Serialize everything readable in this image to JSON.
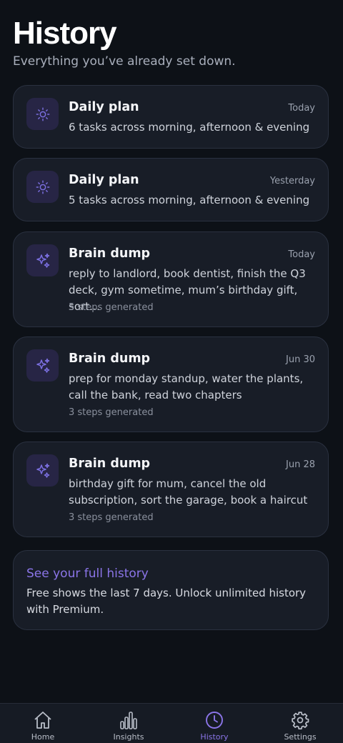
{
  "header": {
    "title": "History",
    "subtitle": "Everything you’ve already set down."
  },
  "entries": [
    {
      "title": "Daily plan",
      "date": "Today",
      "description": "6 tasks across morning, afternoon & evening",
      "icon": "sun-icon"
    },
    {
      "title": "Daily plan",
      "date": "Yesterday",
      "description": "5 tasks across morning, afternoon & evening",
      "icon": "sun-icon"
    },
    {
      "title": "Brain dump",
      "date": "Today",
      "description": "reply to landlord, book dentist, finish the Q3 deck, gym sometime, mum’s birthday gift, sort…",
      "meta": "5 steps generated",
      "icon": "sparkles-icon"
    },
    {
      "title": "Brain dump",
      "date": "Jun 30",
      "description": "prep for monday standup, water the plants, call the bank, read two chapters",
      "meta": "3 steps generated",
      "icon": "sparkles-icon"
    },
    {
      "title": "Brain dump",
      "date": "Jun 28",
      "description": "birthday gift for mum, cancel the old subscription, sort the garage, book a haircut",
      "meta": "3 steps generated",
      "icon": "sparkles-icon"
    }
  ],
  "premium": {
    "title": "See your full history",
    "text": "Free shows the last 7 days. Unlock unlimited history with Premium."
  },
  "nav": [
    {
      "label": "Home",
      "icon": "home-icon"
    },
    {
      "label": "Insights",
      "icon": "bar-chart-icon"
    },
    {
      "label": "History",
      "icon": "clock-icon",
      "active": true
    },
    {
      "label": "Settings",
      "icon": "gear-icon"
    }
  ],
  "colors": {
    "background": "#0d1117",
    "card": "#181d27",
    "accent": "#8b75e8",
    "icon_bg": "#272545"
  }
}
